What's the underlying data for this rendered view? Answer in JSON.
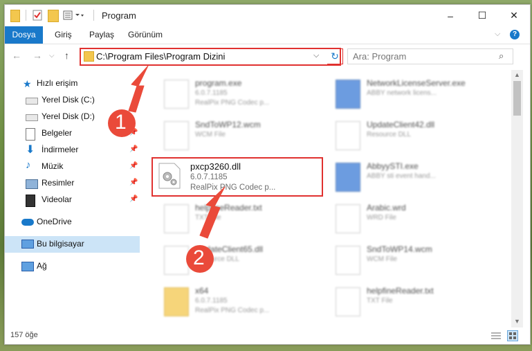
{
  "titlebar": {
    "title": "Program",
    "minimize": "–",
    "maximize": "☐",
    "close": "✕"
  },
  "ribbon": {
    "file": "Dosya",
    "home": "Giriş",
    "share": "Paylaş",
    "view": "Görünüm"
  },
  "nav": {
    "back": "←",
    "forward": "→",
    "up": "↑",
    "address": "C:\\Program Files\\Program Dizini",
    "search_placeholder": "Ara: Program"
  },
  "sidebar": {
    "quick_access": "Hızlı erişim",
    "items": [
      {
        "label": "Yerel Disk (C:)",
        "pinned": false
      },
      {
        "label": "Yerel Disk (D:)",
        "pinned": false
      },
      {
        "label": "Belgeler",
        "pinned": true
      },
      {
        "label": "İndirmeler",
        "pinned": true
      },
      {
        "label": "Müzik",
        "pinned": true
      },
      {
        "label": "Resimler",
        "pinned": true
      },
      {
        "label": "Videolar",
        "pinned": true
      }
    ],
    "onedrive": "OneDrive",
    "this_pc": "Bu bilgisayar",
    "network": "Ağ"
  },
  "files": {
    "left": [
      {
        "name": "program.exe",
        "l1": "6.0.7.1185",
        "l2": "RealPix PNG Codec p...",
        "icon": "app-icon"
      },
      {
        "name": "SndToWP12.wcm",
        "l1": "WCM File",
        "l2": "",
        "icon": "file-icon"
      },
      {
        "name": "pxcp3260.dll",
        "l1": "6.0.7.1185",
        "l2": "RealPix PNG Codec p...",
        "icon": "dll-icon"
      },
      {
        "name": "helpfineReader.txt",
        "l1": "TXT File",
        "l2": "",
        "icon": "file-icon"
      },
      {
        "name": "UpdateClient65.dll",
        "l1": "Resource DLL",
        "l2": "",
        "icon": "dll-icon"
      },
      {
        "name": "x64",
        "l1": "6.0.7.1185",
        "l2": "RealPix PNG Codec p...",
        "icon": "folder-icon"
      }
    ],
    "right": [
      {
        "name": "NetworkLicenseServer.exe",
        "l1": "ABBY network licens...",
        "l2": "",
        "icon": "exe-icon"
      },
      {
        "name": "UpdateClient42.dll",
        "l1": "Resource DLL",
        "l2": "",
        "icon": "dll-icon"
      },
      {
        "name": "AbbyySTI.exe",
        "l1": "ABBY sti event hand...",
        "l2": "",
        "icon": "exe-icon"
      },
      {
        "name": "Arabic.wrd",
        "l1": "WRD File",
        "l2": "",
        "icon": "file-icon"
      },
      {
        "name": "SndToWP14.wcm",
        "l1": "WCM File",
        "l2": "",
        "icon": "file-icon"
      },
      {
        "name": "helpfineReader.txt",
        "l1": "TXT File",
        "l2": "",
        "icon": "file-icon"
      }
    ]
  },
  "status": {
    "count": "157 öğe"
  },
  "annotations": {
    "step1": "1",
    "step2": "2"
  },
  "colors": {
    "accent": "#1979ca",
    "highlight": "#e0312f",
    "selection": "#cce4f7"
  }
}
